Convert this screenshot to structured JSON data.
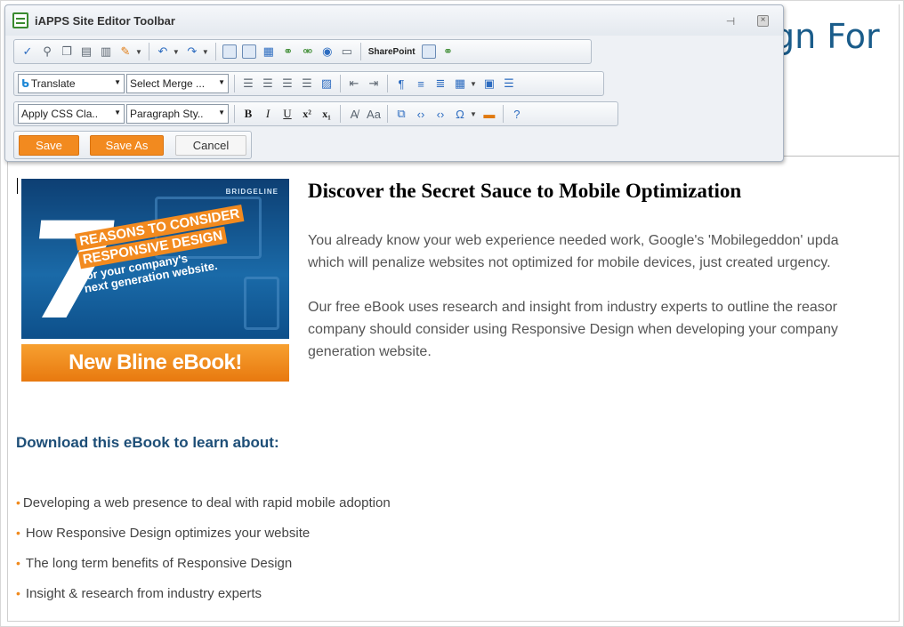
{
  "page": {
    "behind_title": "gn For",
    "heading": "Discover the Secret Sauce to Mobile Optimization",
    "paragraph1_lines": [
      "You already know your web experience needed work, Google's 'Mobilegeddon' upda",
      "which will penalize websites not optimized for mobile devices, just created urgency."
    ],
    "paragraph2_lines": [
      "Our free eBook uses research and insight from industry experts to outline the reasor",
      "company should consider using Responsive Design when developing your company",
      "generation website."
    ],
    "download_heading": "Download this eBook to learn about:",
    "bullets": [
      "Developing a web presence to deal with rapid mobile adoption",
      "How Responsive Design optimizes your website",
      "The long term benefits of Responsive Design",
      "Insight & research from industry experts"
    ],
    "bullet_marker": "•"
  },
  "ebook": {
    "brand": "BRIDGELINE",
    "number": "7",
    "line1": "Reasons to Consider",
    "line2": "Responsive Design",
    "line3": "for your company's",
    "line4": "next generation website.",
    "cta": "New Bline eBook!"
  },
  "toolbar": {
    "title": "iAPPS Site Editor Toolbar",
    "pin_icon": "pin-icon",
    "close_icon": "close-icon",
    "sharepoint_label": "SharePoint",
    "translate_label": "Translate",
    "merge_label": "Select Merge ...",
    "css_class_label": "Apply CSS Cla..",
    "paragraph_style_label": "Paragraph Sty..",
    "bold": "B",
    "italic": "I",
    "underline": "U",
    "superscript": "x²",
    "subscript": "x₁",
    "omega": "Ω",
    "save": "Save",
    "save_as": "Save As",
    "cancel": "Cancel"
  },
  "colors": {
    "accent_orange": "#f28a1f",
    "heading_blue": "#1d4e77",
    "title_blue": "#1a5c8a"
  }
}
